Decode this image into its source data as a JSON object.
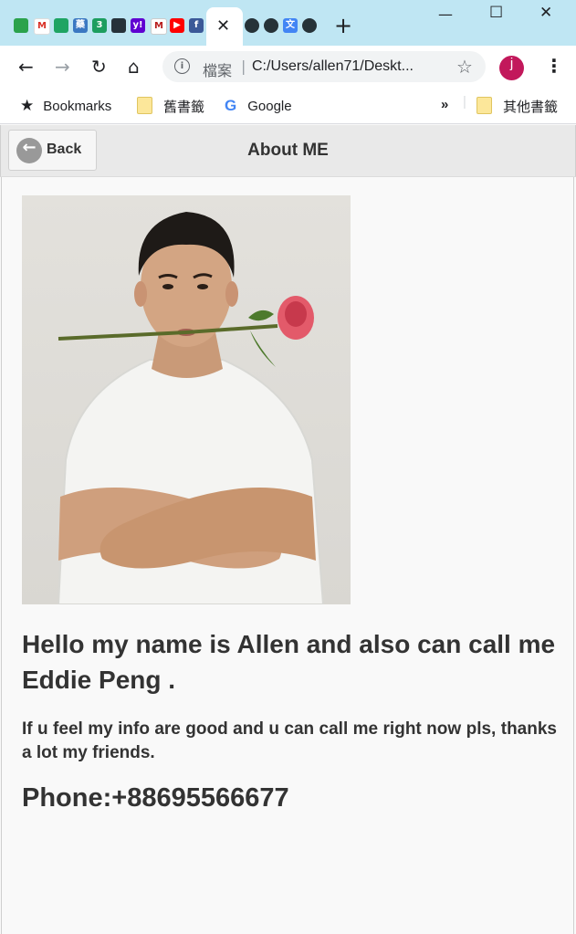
{
  "browser": {
    "address_scheme": "檔案",
    "url": "C:/Users/allen71/Deskt...",
    "avatar_letter": "j",
    "bookmarks": {
      "item1": "Bookmarks",
      "item2": "舊書籤",
      "item3": "Google",
      "overflow": "»",
      "other": "其他書籤"
    }
  },
  "page": {
    "back_label": "Back",
    "title": "About ME",
    "intro": "Hello my name is Allen and also can call me Eddie Peng .",
    "description": "If u feel my info are good and u can call me right now pls, thanks a lot my friends.",
    "phone": "Phone:+88695566677"
  },
  "colors": {
    "tabstrip": "#bfe6f3",
    "header": "#e9e9e9",
    "avatar": "#c2185b"
  }
}
